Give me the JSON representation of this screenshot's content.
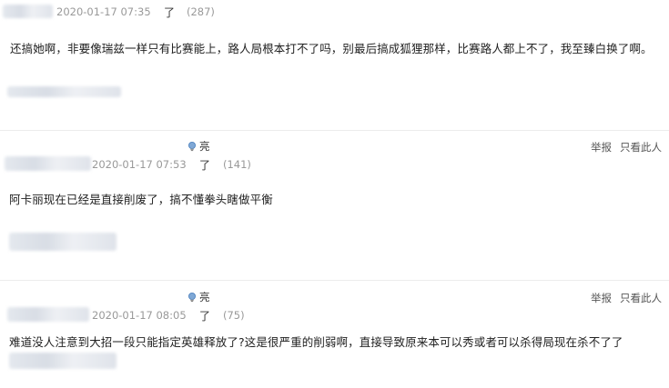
{
  "posts": [
    {
      "timestamp": "2020-01-17 07:35",
      "ding_label": "了",
      "count": "(287)",
      "body": "还搞她啊，非要像瑞兹一样只有比赛能上，路人局根本打不了吗，别最后搞成狐狸那样，比赛路人都上不了，我至臻白换了啊。"
    },
    {
      "badge_label": "亮",
      "report_label": "举报",
      "only_author_label": "只看此人",
      "timestamp": "2020-01-17 07:53",
      "ding_label": "了",
      "count": "(141)",
      "body": "阿卡丽现在已经是直接削废了，搞不懂拳头瞎做平衡"
    },
    {
      "badge_label": "亮",
      "report_label": "举报",
      "only_author_label": "只看此人",
      "timestamp": "2020-01-17 08:05",
      "ding_label": "了",
      "count": "(75)",
      "body": "难道没人注意到大招一段只能指定英雄释放了?这是很严重的削弱啊，直接导致原来本可以秀或者可以杀得局现在杀不了了"
    }
  ],
  "icons": {
    "badge": "lightbulb-icon"
  },
  "colors": {
    "link_hover": "#2d64b3",
    "divider": "#ececec"
  }
}
